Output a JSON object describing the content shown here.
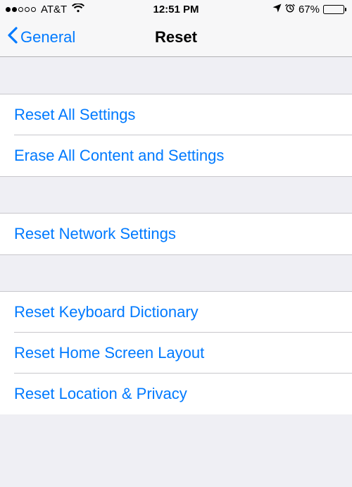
{
  "statusBar": {
    "carrier": "AT&T",
    "time": "12:51 PM",
    "batteryPct": "67%"
  },
  "nav": {
    "back": "General",
    "title": "Reset"
  },
  "groups": [
    {
      "items": [
        {
          "label": "Reset All Settings"
        },
        {
          "label": "Erase All Content and Settings"
        }
      ]
    },
    {
      "items": [
        {
          "label": "Reset Network Settings"
        }
      ]
    },
    {
      "items": [
        {
          "label": "Reset Keyboard Dictionary"
        },
        {
          "label": "Reset Home Screen Layout"
        },
        {
          "label": "Reset Location & Privacy"
        }
      ]
    }
  ]
}
